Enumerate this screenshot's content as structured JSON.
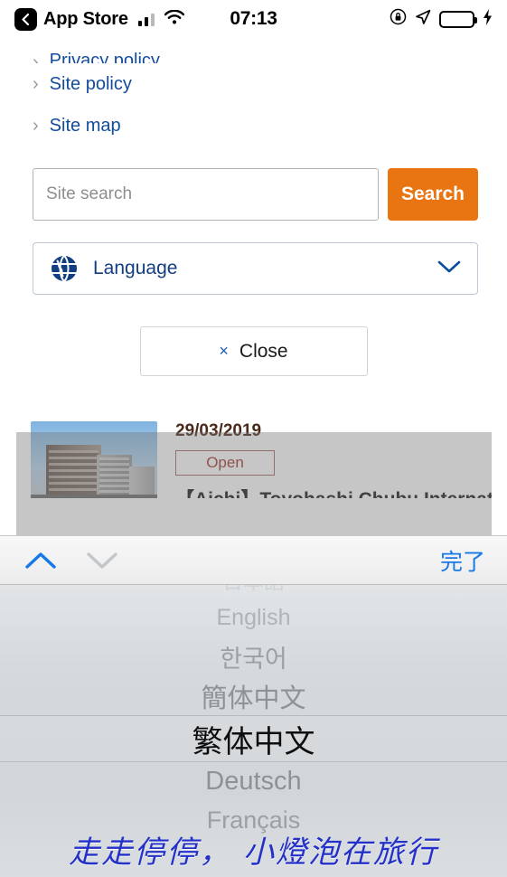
{
  "status_bar": {
    "back_app": "App Store",
    "time": "07:13",
    "icons": {
      "back": "back-chevron-icon",
      "signal": "cellular-signal-icon",
      "wifi": "wifi-icon",
      "rotation_lock": "rotation-lock-icon",
      "location": "location-arrow-icon",
      "battery": "battery-icon",
      "charging": "lightning-bolt-icon"
    },
    "battery_color": "#2fd158"
  },
  "footer_links": [
    {
      "label": "Privacy policy"
    },
    {
      "label": "Site policy"
    },
    {
      "label": "Site map"
    }
  ],
  "search": {
    "placeholder": "Site search",
    "value": "",
    "button_label": "Search",
    "button_color": "#e87511"
  },
  "language_select": {
    "label": "Language",
    "icon": "globe-icon",
    "chevron": "chevron-down-icon",
    "accent": "#123e82"
  },
  "close": {
    "label": "Close",
    "x_glyph": "×"
  },
  "news_card": {
    "date": "29/03/2019",
    "badge": "Open",
    "badge_color": "#a33a2a",
    "title": "【Aichi】Toyohashi Chubu International",
    "thumbnail": "building-photo"
  },
  "picker": {
    "toolbar": {
      "prev_label": "∧",
      "next_label": "∨",
      "done_label": "完了",
      "done_color": "#1779e8",
      "prev_enabled": true,
      "next_enabled": false
    },
    "options": [
      "日本語",
      "English",
      "한국어",
      "簡体中文",
      "繁体中文",
      "Deutsch",
      "Français"
    ],
    "selected_index": 4,
    "selected_value": "繁体中文"
  },
  "watermark": {
    "text": "走走停停， 小燈泡在旅行",
    "color": "#2431c8"
  }
}
